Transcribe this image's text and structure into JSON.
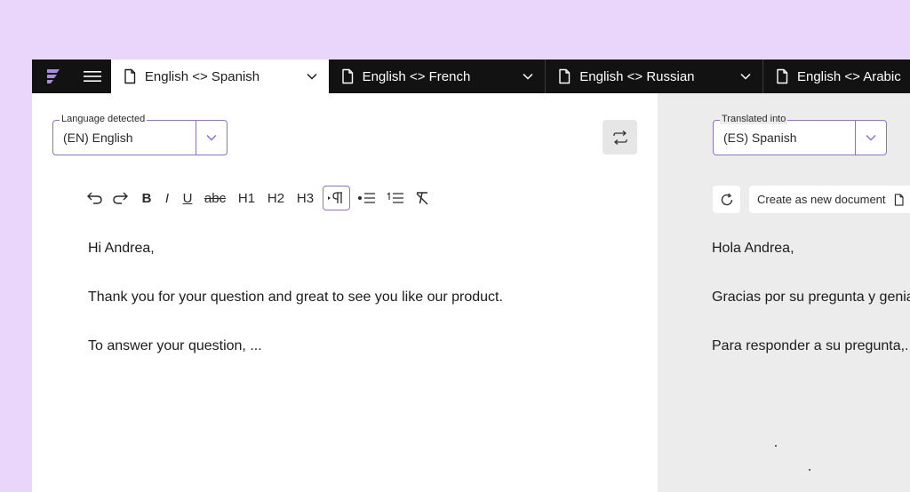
{
  "tabs": [
    {
      "label": "English <> Spanish",
      "active": true
    },
    {
      "label": "English <> French",
      "active": false
    },
    {
      "label": "English <> Russian",
      "active": false
    },
    {
      "label": "English <> Arabic",
      "active": false
    }
  ],
  "source": {
    "legend": "Language detected",
    "value": "(EN)  English",
    "lines": [
      "Hi Andrea,",
      "Thank you for your question and great to see you like our product.",
      "To answer your question, ..."
    ]
  },
  "toolbar": {
    "bold": "B",
    "italic": "I",
    "underline": "U",
    "strike": "abc",
    "h1": "H1",
    "h2": "H2",
    "h3": "H3"
  },
  "target": {
    "legend": "Translated into",
    "value": "(ES)  Spanish",
    "create_label": "Create as new document",
    "lines": [
      "Hola Andrea,",
      "Gracias por su pregunta y genial",
      "Para responder a su pregunta,..."
    ]
  },
  "colors": {
    "background": "#e9d6fa",
    "topbar": "#121212",
    "accent": "#8f72c9",
    "logo": "#a98be0"
  }
}
